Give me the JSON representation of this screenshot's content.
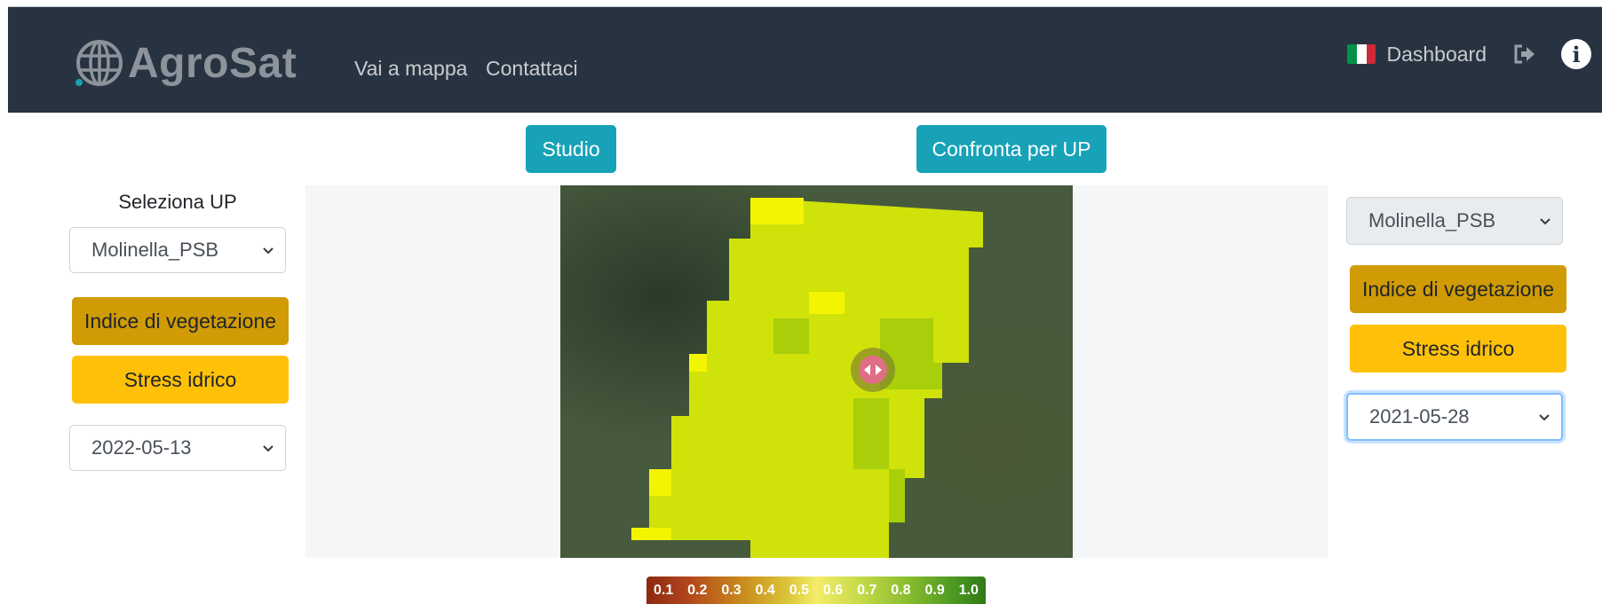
{
  "app": {
    "name": "AgroSat"
  },
  "navbar": {
    "links": [
      "Vai a mappa",
      "Contattaci"
    ],
    "dashboard_label": "Dashboard",
    "flag_colors": [
      "#009246",
      "#ffffff",
      "#ce2b37"
    ],
    "background": "#283341"
  },
  "toolbar": {
    "study_label": "Studio",
    "compare_label": "Confronta per UP"
  },
  "left_panel": {
    "select_label": "Seleziona UP",
    "up_value": "Molinella_PSB",
    "vegetation_label": "Indice di vegetazione",
    "stress_label": "Stress idrico",
    "date_value": "2022-05-13"
  },
  "right_panel": {
    "up_value": "Molinella_PSB",
    "vegetation_label": "Indice di vegetazione",
    "stress_label": "Stress idrico",
    "date_value": "2021-05-28"
  },
  "legend": {
    "values": [
      "0.1",
      "0.2",
      "0.3",
      "0.4",
      "0.5",
      "0.6",
      "0.7",
      "0.8",
      "0.9",
      "1.0"
    ]
  },
  "colors": {
    "teal": "#17a2b8",
    "vegetation_button": "#d09b05",
    "stress_button": "#ffc107",
    "field_yellow": "#f3f500",
    "field_lime": "#cfe20a",
    "field_green": "#a9cf0a"
  },
  "icons": {
    "logo": "globe-icon",
    "logout": "sign-out-icon",
    "info": "info-circle-icon",
    "slider": "left-right-arrows-icon",
    "dropdown": "chevron-down-icon"
  }
}
